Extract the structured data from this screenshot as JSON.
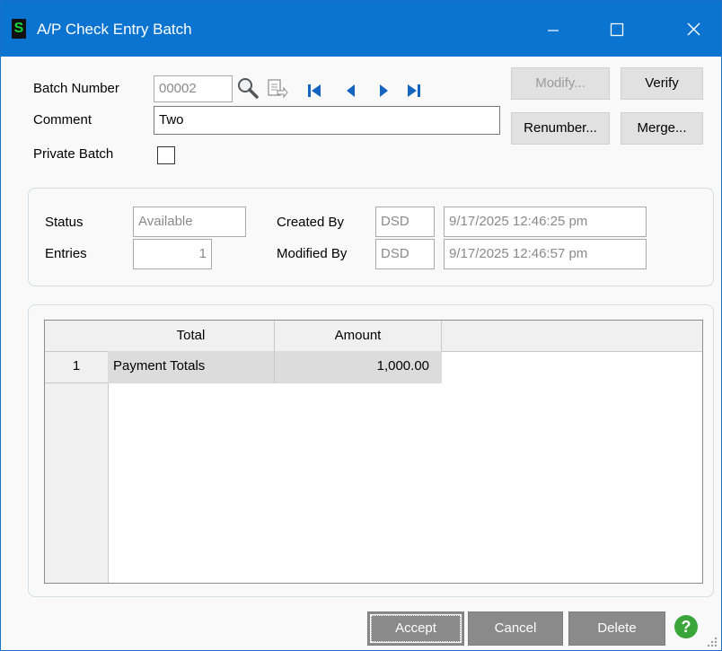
{
  "window": {
    "title": "A/P Check Entry Batch",
    "app_icon_glyph": "S",
    "controls": {
      "minimize": "minimize-icon",
      "maximize": "maximize-icon",
      "close": "close-icon"
    }
  },
  "header": {
    "batch_number_label": "Batch Number",
    "batch_number_value": "00002",
    "comment_label": "Comment",
    "comment_value": "Two",
    "private_batch_label": "Private Batch",
    "private_batch_checked": false,
    "icons": [
      "search-icon",
      "batch-list-icon",
      "first-record-icon",
      "previous-record-icon",
      "next-record-icon",
      "last-record-icon"
    ]
  },
  "buttons": {
    "modify": "Modify...",
    "verify": "Verify",
    "renumber": "Renumber...",
    "merge": "Merge..."
  },
  "status_panel": {
    "status_label": "Status",
    "status_value": "Available",
    "entries_label": "Entries",
    "entries_value": "1",
    "created_by_label": "Created By",
    "created_by_user": "DSD",
    "created_by_datetime": "9/17/2025 12:46:25 pm",
    "modified_by_label": "Modified By",
    "modified_by_user": "DSD",
    "modified_by_datetime": "9/17/2025 12:46:57 pm"
  },
  "totals_grid": {
    "columns": [
      "Total",
      "Amount"
    ],
    "rows": [
      {
        "num": "1",
        "total": "Payment Totals",
        "amount": "1,000.00"
      }
    ]
  },
  "footer": {
    "accept": "Accept",
    "cancel": "Cancel",
    "delete": "Delete",
    "help_icon": "help-icon"
  },
  "colors": {
    "titlebar": "#0a74d0",
    "footer_button": "#8a8a8a",
    "help": "#3aa53a",
    "nav_icons": "#1565c0"
  }
}
